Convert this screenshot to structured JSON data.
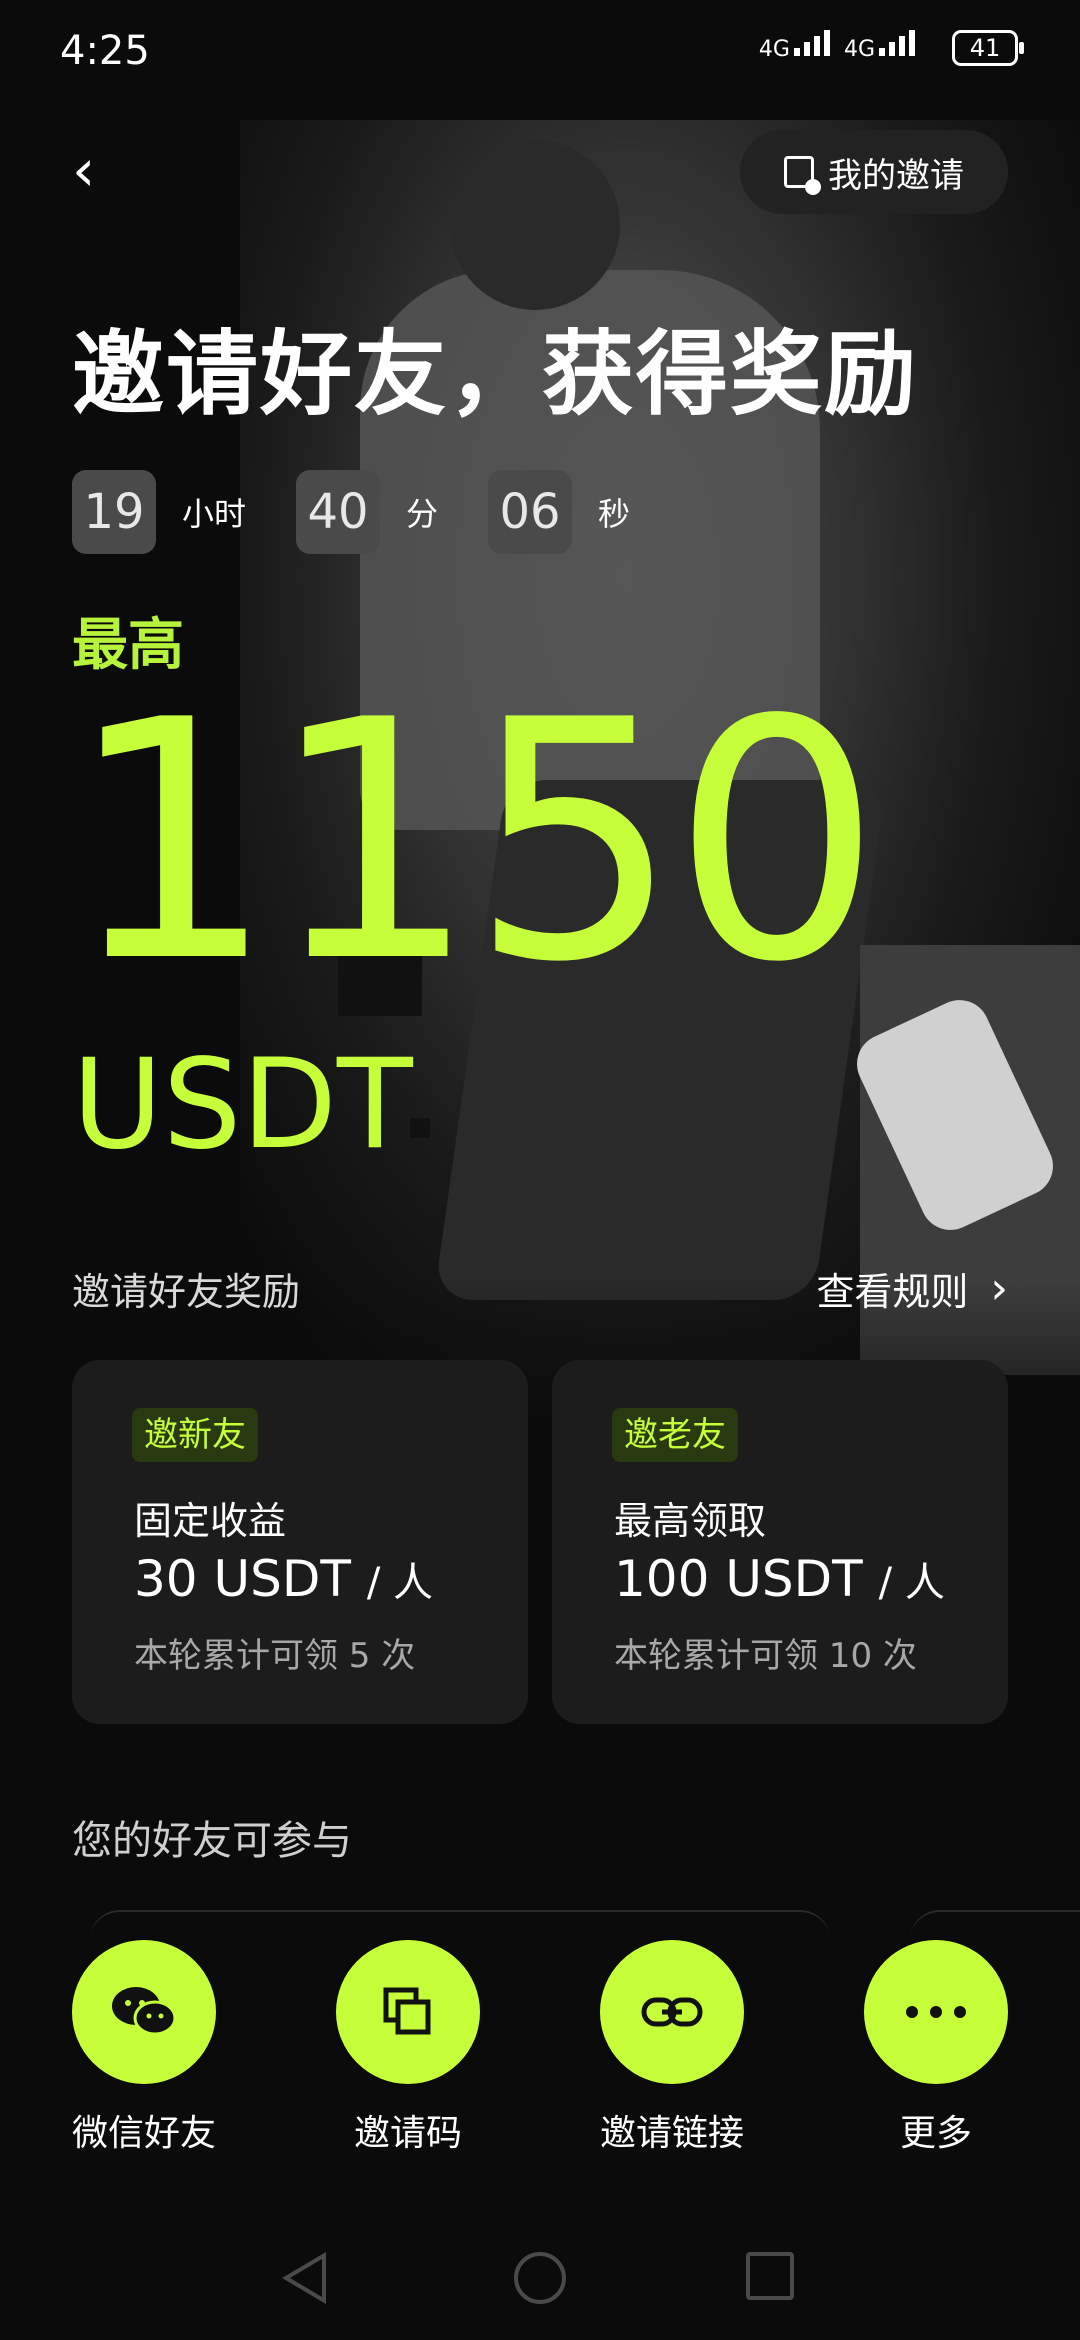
{
  "status_bar": {
    "time": "4:25",
    "signal_1": "4G",
    "signal_2": "4G",
    "battery": "41"
  },
  "header": {
    "my_invite_label": "我的邀请"
  },
  "hero": {
    "title": "邀请好友，获得奖励",
    "countdown": {
      "hours": "19",
      "hours_unit": "小时",
      "minutes": "40",
      "minutes_unit": "分",
      "seconds": "06",
      "seconds_unit": "秒"
    },
    "max_label": "最高",
    "amount": "1150",
    "unit": "USDT"
  },
  "reward_section": {
    "title": "邀请好友奖励",
    "rules_link": "查看规则"
  },
  "cards": [
    {
      "badge": "邀新友",
      "label": "固定收益",
      "value": "30 USDT",
      "per": "/ 人",
      "note": "本轮累计可领 5 次"
    },
    {
      "badge": "邀老友",
      "label": "最高领取",
      "value": "100 USDT",
      "per": "/ 人",
      "note": "本轮累计可领 10 次"
    }
  ],
  "friends_section": {
    "title": "您的好友可参与"
  },
  "share_options": [
    {
      "label": "微信好友",
      "icon": "wechat-icon"
    },
    {
      "label": "邀请码",
      "icon": "copy-icon"
    },
    {
      "label": "邀请链接",
      "icon": "link-icon"
    },
    {
      "label": "更多",
      "icon": "more-icon"
    }
  ],
  "colors": {
    "accent": "#c6ff3a",
    "background": "#0b0b0b",
    "card": "#1c1c1c"
  }
}
